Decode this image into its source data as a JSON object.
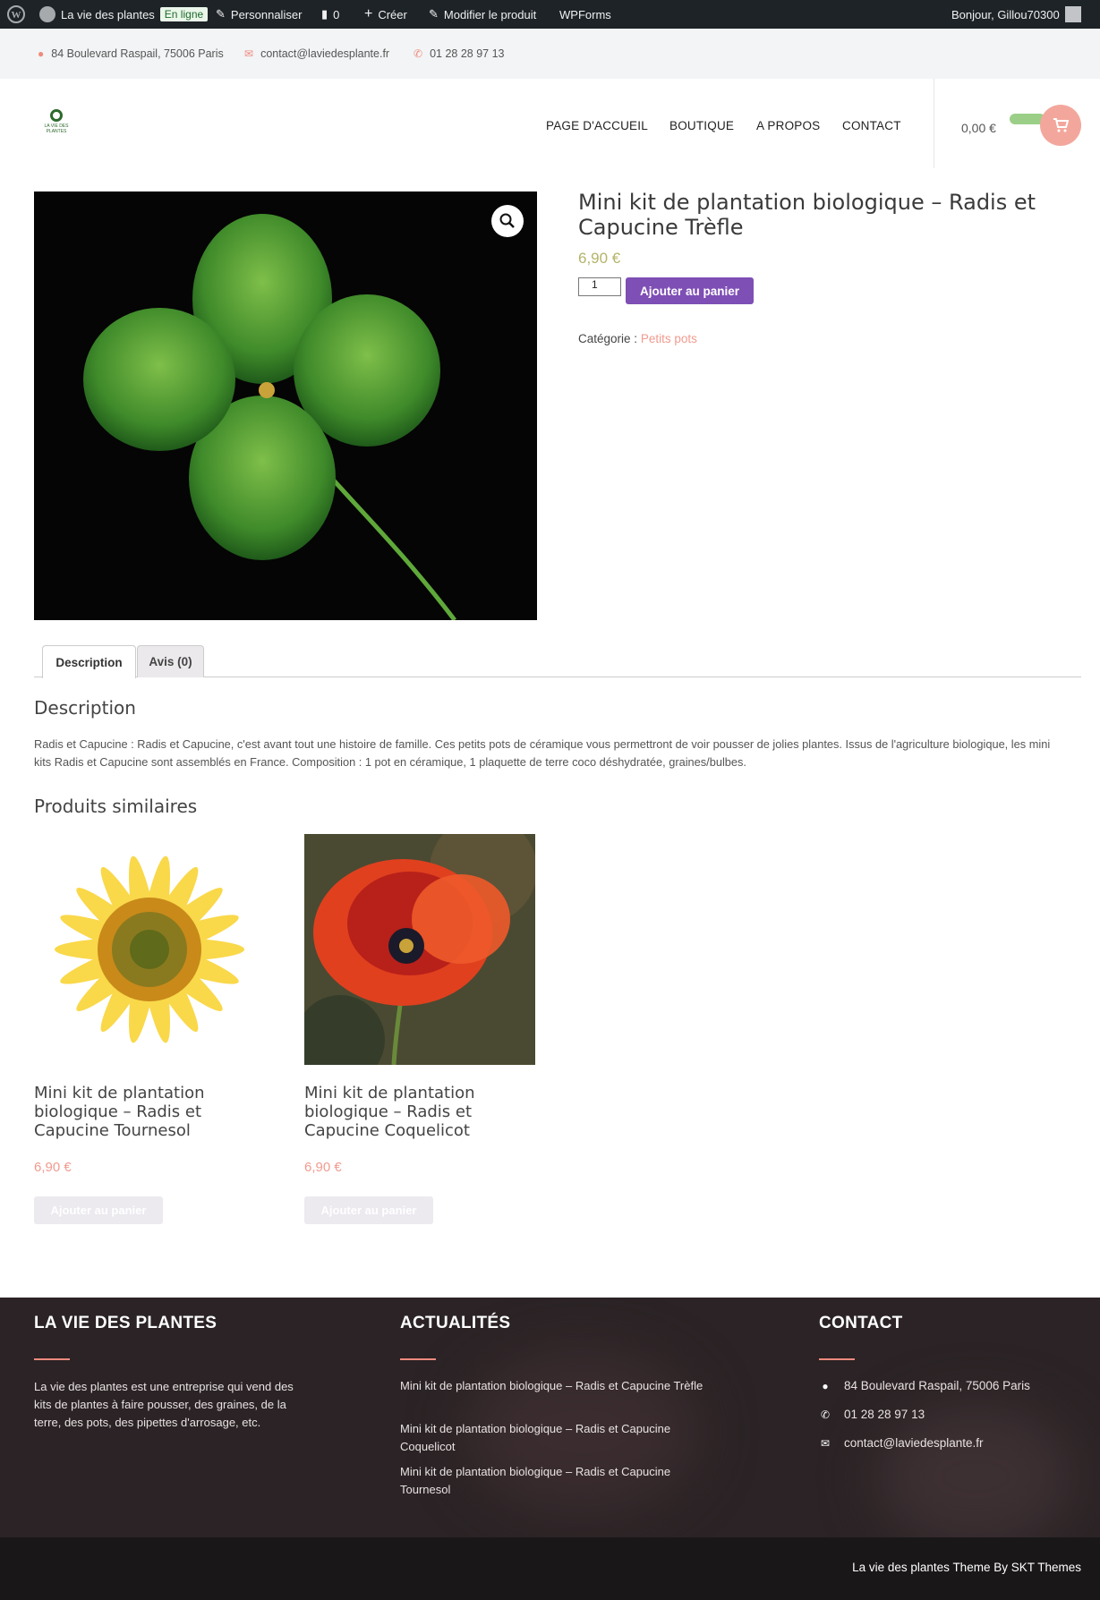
{
  "admin_bar": {
    "site_name": "La vie des plantes",
    "status_badge": "En ligne",
    "customize": "Personnaliser",
    "comments_count": "0",
    "create": "Créer",
    "edit_product": "Modifier le produit",
    "wpforms": "WPForms",
    "greeting": "Bonjour, Gillou70300"
  },
  "top_bar": {
    "address": "84 Boulevard Raspail, 75006 Paris",
    "email": "contact@laviedesplante.fr",
    "phone": "01 28 28 97 13"
  },
  "header": {
    "logo_text": "LA VIE DES PLANTES",
    "nav": [
      "PAGE D'ACCUEIL",
      "BOUTIQUE",
      "A PROPOS",
      "CONTACT"
    ],
    "cart_total": "0,00 €"
  },
  "product": {
    "title": "Mini kit de plantation biologique – Radis et Capucine Trèfle",
    "price": "6,90 €",
    "quantity": "1",
    "add_to_cart": "Ajouter au panier",
    "category_label": "Catégorie :",
    "category": "Petits pots"
  },
  "tabs": [
    "Description",
    "Avis (0)"
  ],
  "description": {
    "heading": "Description",
    "text": "Radis et Capucine : Radis et Capucine, c'est avant tout une histoire de famille. Ces petits pots de céramique vous permettront de voir pousser de jolies plantes. Issus de l'agriculture biologique, les mini kits Radis et Capucine sont assemblés en France. Composition : 1 pot en céramique, 1 plaquette de terre coco déshydratée, graines/bulbes."
  },
  "related": {
    "heading": "Produits similaires",
    "items": [
      {
        "title": "Mini kit de plantation biologique – Radis et Capucine Tournesol",
        "price": "6,90 €",
        "button": "Ajouter au panier"
      },
      {
        "title": "Mini kit de plantation biologique – Radis et Capucine Coquelicot",
        "price": "6,90 €",
        "button": "Ajouter au panier"
      }
    ]
  },
  "footer": {
    "about_heading": "LA VIE DES PLANTES",
    "about_text": "La vie des plantes est une entreprise qui vend des kits de plantes à faire pousser, des graines, de la terre, des pots, des pipettes d'arrosage, etc.",
    "news_heading": "ACTUALITÉS",
    "news": [
      "Mini kit de plantation biologique – Radis et Capucine Trèfle",
      "Mini kit de plantation biologique – Radis et Capucine Coquelicot",
      "Mini kit de plantation biologique – Radis et Capucine Tournesol"
    ],
    "contact_heading": "CONTACT",
    "address": "84 Boulevard Raspail, 75006 Paris",
    "phone": "01 28 28 97 13",
    "email": "contact@laviedesplante.fr",
    "credit": "La vie des plantes Theme By SKT Themes"
  },
  "icons": {
    "wordpress": "wordpress-logo-icon",
    "site": "dashboard-icon",
    "brush": "brush-icon",
    "comment": "comment-icon",
    "plus": "plus-icon",
    "pencil": "pencil-icon",
    "location": "map-marker-icon",
    "mail": "envelope-icon",
    "phone": "phone-icon",
    "cart": "shopping-cart-icon",
    "zoom": "magnifier-icon"
  },
  "colors": {
    "accent_purple": "#7e4fb5",
    "accent_salmon": "#f29a8f",
    "price_olive": "#b5b36a",
    "footer_bg": "#2b2325"
  }
}
